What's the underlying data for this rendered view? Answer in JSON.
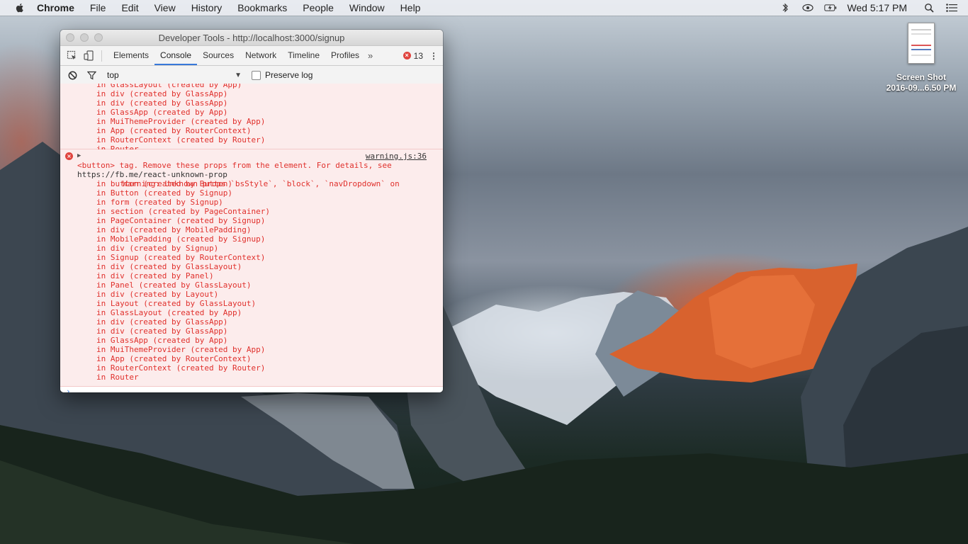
{
  "menubar": {
    "items": [
      "Chrome",
      "File",
      "Edit",
      "View",
      "History",
      "Bookmarks",
      "People",
      "Window",
      "Help"
    ],
    "clock": "Wed 5:17 PM"
  },
  "desktop": {
    "icon_label_1": "Screen Shot",
    "icon_label_2": "2016-09...6.50 PM"
  },
  "devtools": {
    "title": "Developer Tools - http://localhost:3000/signup",
    "tabs": [
      "Elements",
      "Console",
      "Sources",
      "Network",
      "Timeline",
      "Profiles"
    ],
    "more_tabs": "»",
    "active_tab": "Console",
    "error_count": "13",
    "context": "top",
    "preserve_log": "Preserve log"
  },
  "console": {
    "prev_stack": [
      "in GlassLayout (created by App)",
      "in div (created by GlassApp)",
      "in div (created by GlassApp)",
      "in GlassApp (created by App)",
      "in MuiThemeProvider (created by App)",
      "in App (created by RouterContext)",
      "in RouterContext (created by Router)",
      "in Router"
    ],
    "warning_line1": "Warning: Unknown props `bsStyle`, `block`, `navDropdown` on",
    "warning_source": "warning.js:36",
    "warning_line2": "<button> tag. Remove these props from the element. For details, see",
    "warning_link": "https://fb.me/react-unknown-prop",
    "stack": [
      "in button (created by Button)",
      "in Button (created by Signup)",
      "in form (created by Signup)",
      "in section (created by PageContainer)",
      "in PageContainer (created by Signup)",
      "in div (created by MobilePadding)",
      "in MobilePadding (created by Signup)",
      "in div (created by Signup)",
      "in Signup (created by RouterContext)",
      "in div (created by GlassLayout)",
      "in div (created by Panel)",
      "in Panel (created by GlassLayout)",
      "in div (created by Layout)",
      "in Layout (created by GlassLayout)",
      "in GlassLayout (created by App)",
      "in div (created by GlassApp)",
      "in div (created by GlassApp)",
      "in GlassApp (created by App)",
      "in MuiThemeProvider (created by App)",
      "in App (created by RouterContext)",
      "in RouterContext (created by Router)",
      "in Router"
    ],
    "prompt": "›"
  }
}
